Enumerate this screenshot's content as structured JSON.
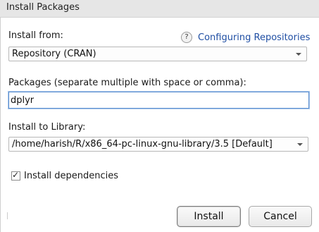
{
  "window": {
    "title": "Install Packages"
  },
  "install_from": {
    "label": "Install from:",
    "selected": "Repository (CRAN)",
    "help_icon": "question-mark-icon",
    "help_link": "Configuring Repositories"
  },
  "packages": {
    "label": "Packages (separate multiple with space or comma):",
    "value": "dplyr"
  },
  "library": {
    "label": "Install to Library:",
    "selected": "/home/harish/R/x86_64-pc-linux-gnu-library/3.5 [Default]"
  },
  "dependencies": {
    "label": "Install dependencies",
    "checked": true,
    "check_glyph": "✓"
  },
  "buttons": {
    "install": "Install",
    "cancel": "Cancel"
  }
}
